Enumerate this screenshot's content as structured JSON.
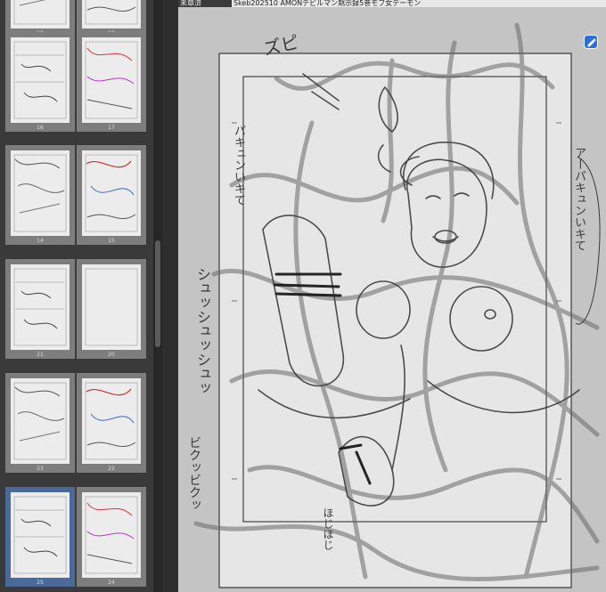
{
  "window": {
    "doc_tab": "未章済",
    "title": "Skeb202510 AMONデビルマン黙示録5巻モブ女デーモン"
  },
  "page_panel": {
    "thumbnails": [
      {
        "page": "18",
        "selected": false
      },
      {
        "page": "19",
        "selected": false
      },
      {
        "page": "16",
        "selected": false
      },
      {
        "page": "17",
        "selected": false
      },
      {
        "page": "14",
        "selected": false
      },
      {
        "page": "15",
        "selected": false
      },
      {
        "page": "21",
        "selected": false
      },
      {
        "page": "20",
        "selected": false
      },
      {
        "page": "23",
        "selected": false
      },
      {
        "page": "22",
        "selected": false
      },
      {
        "page": "25",
        "selected": true
      },
      {
        "page": "24",
        "selected": false
      }
    ]
  },
  "toolbar": {
    "active_tool_icon": "pen-tool-icon",
    "accent_color": "#2f6fd1"
  },
  "canvas": {
    "sfx": {
      "top": "ズピ",
      "left_vertical_1": "パキュンいキて",
      "right_vertical": "アーパキュンいキて",
      "left_margin": "シュッシュッシュッ",
      "bottom_left": "ビクッビクッ",
      "bottom_center": "ほじほじ"
    }
  },
  "colors": {
    "panel_bg": "#3a3a3a",
    "canvas_bg": "#c4c4c4",
    "paper": "#e6e6e6",
    "sketch": "#555555"
  }
}
